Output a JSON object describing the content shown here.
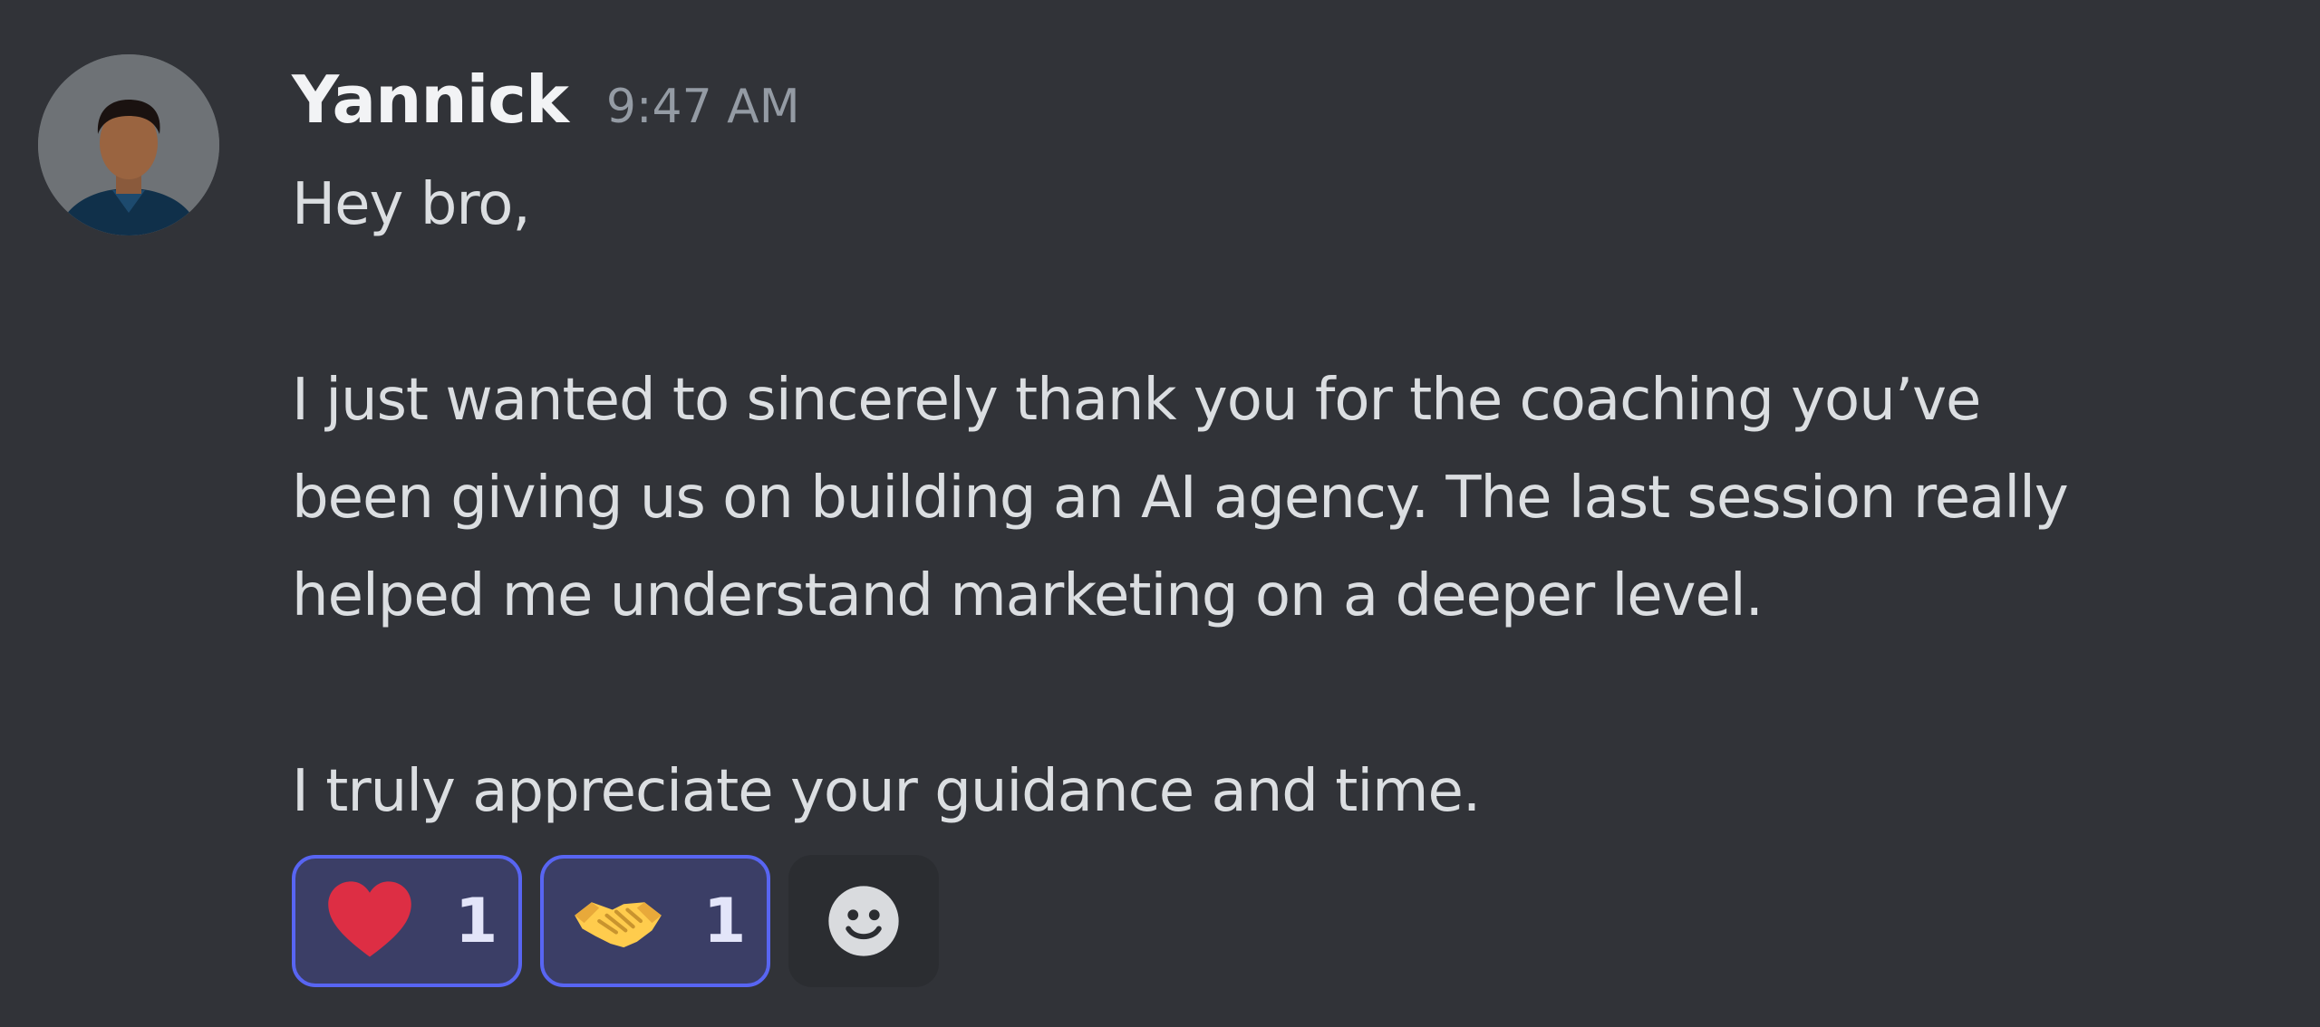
{
  "message": {
    "author": "Yannick",
    "timestamp": "9:47 AM",
    "avatar_icon": "user-avatar",
    "lines": [
      "Hey bro,",
      "",
      "I just wanted to sincerely thank you for the coaching you’ve",
      "been giving us on building an AI agency. The last session really",
      "helped me understand marketing on a deeper level.",
      "",
      "I truly appreciate your guidance and time."
    ]
  },
  "reactions": [
    {
      "emoji": "red-heart",
      "count": "1"
    },
    {
      "emoji": "handshake",
      "count": "1"
    }
  ],
  "add_reaction_icon": "smiley-face-icon",
  "colors": {
    "background": "#313338",
    "reaction_border": "#5865f2",
    "reaction_fill": "#3b3e66"
  }
}
